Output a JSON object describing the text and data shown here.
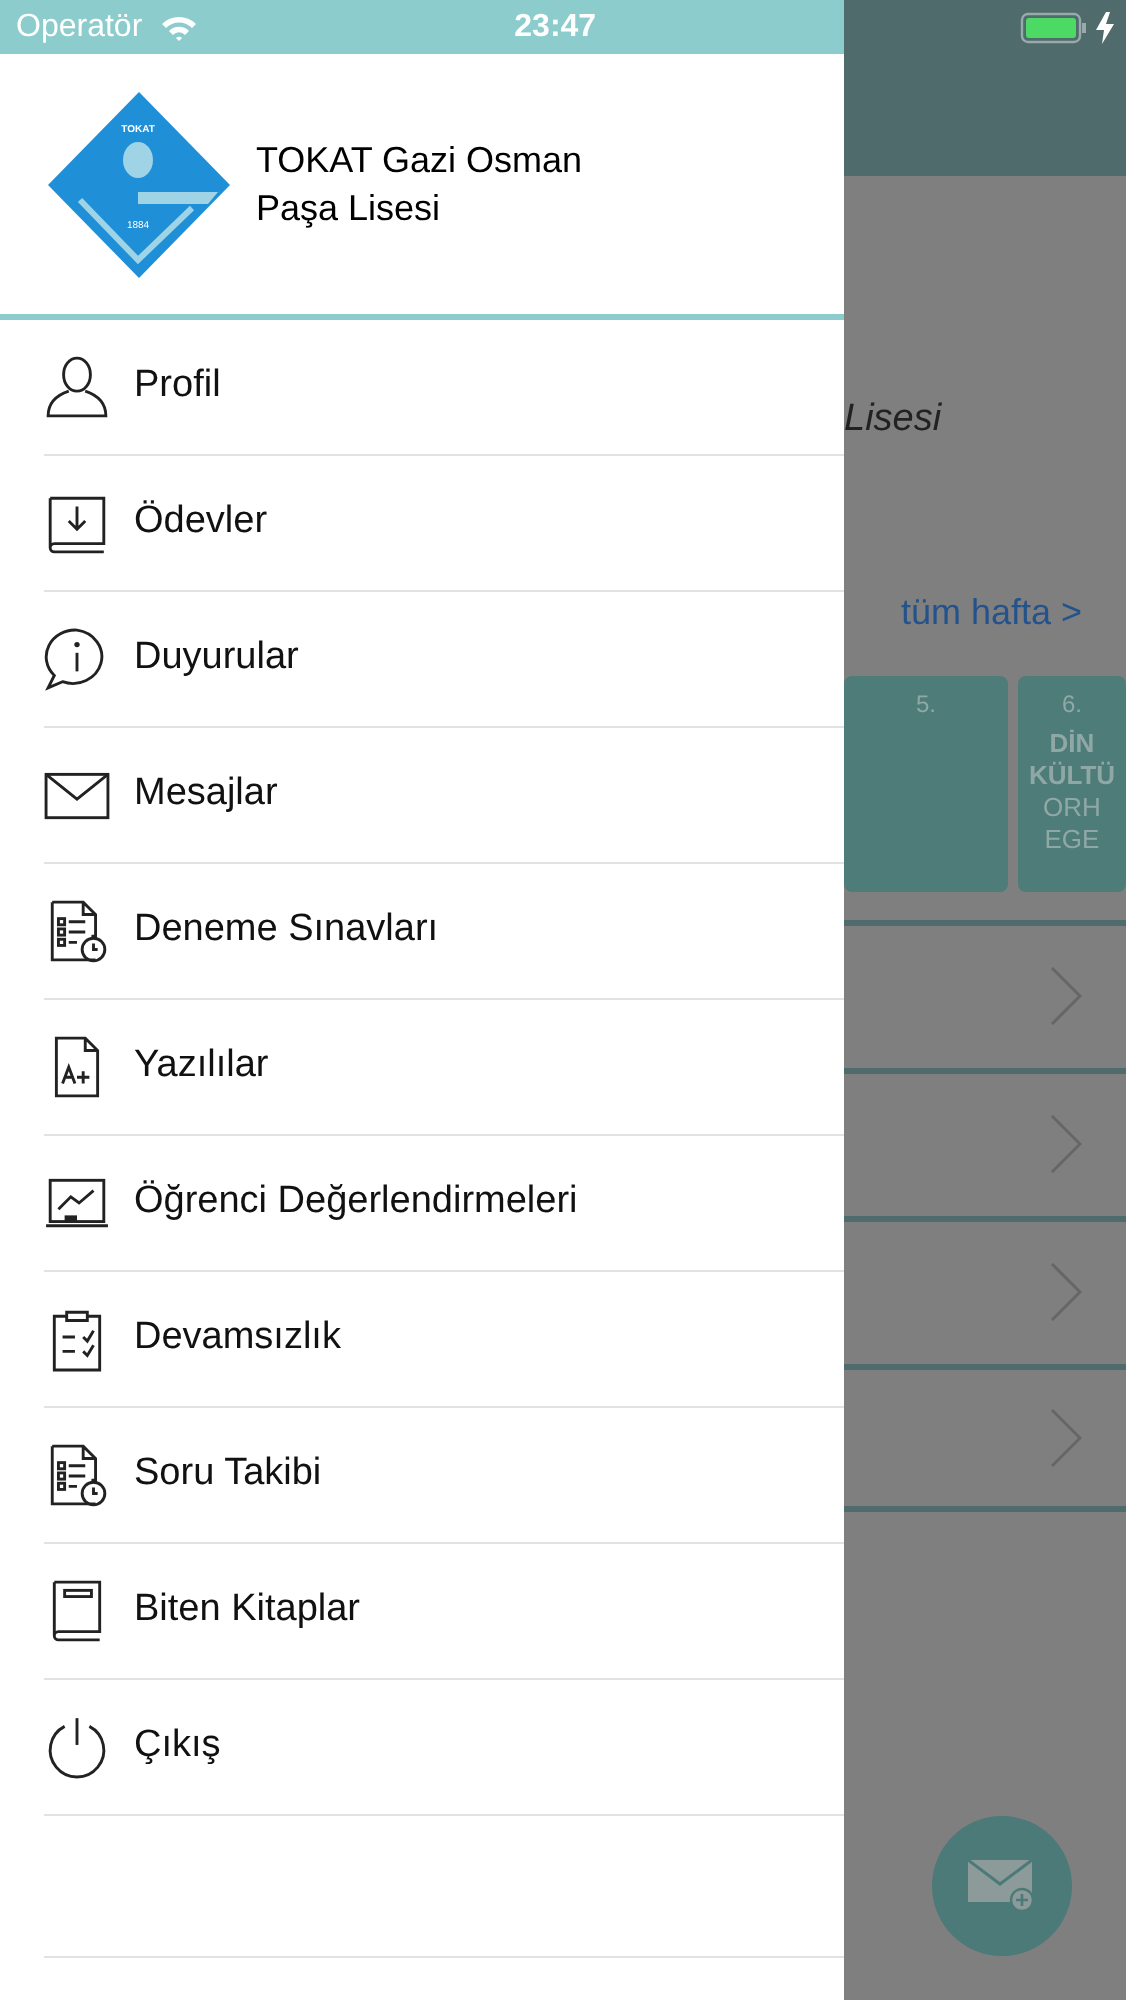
{
  "status_bar": {
    "carrier": "Operatör",
    "time": "23:47"
  },
  "drawer": {
    "logo": {
      "top_text": "TOKAT",
      "year": "1884"
    },
    "school_name": "TOKAT Gazi Osman Paşa Lisesi",
    "menu": [
      {
        "label": "Profil",
        "kind": "person"
      },
      {
        "label": "Ödevler",
        "kind": "book-download"
      },
      {
        "label": "Duyurular",
        "kind": "info"
      },
      {
        "label": "Mesajlar",
        "kind": "mail"
      },
      {
        "label": "Deneme Sınavları",
        "kind": "exam"
      },
      {
        "label": "Yazılılar",
        "kind": "grade"
      },
      {
        "label": "Öğrenci Değerlendirmeleri",
        "kind": "board"
      },
      {
        "label": "Devamsızlık",
        "kind": "clipboard"
      },
      {
        "label": "Soru Takibi",
        "kind": "exam"
      },
      {
        "label": "Biten Kitaplar",
        "kind": "book"
      },
      {
        "label": "Çıkış",
        "kind": "power"
      }
    ]
  },
  "background": {
    "subtitle": "Lisesi",
    "week_link": "tüm hafta >",
    "lessons": [
      {
        "number": "5."
      },
      {
        "number": "6.",
        "lines": [
          {
            "text": "DİN",
            "bold": true
          },
          {
            "text": "KÜLTÜ",
            "bold": true
          },
          {
            "text": "ORH",
            "bold": false
          },
          {
            "text": "EGE",
            "bold": false
          }
        ]
      }
    ]
  }
}
